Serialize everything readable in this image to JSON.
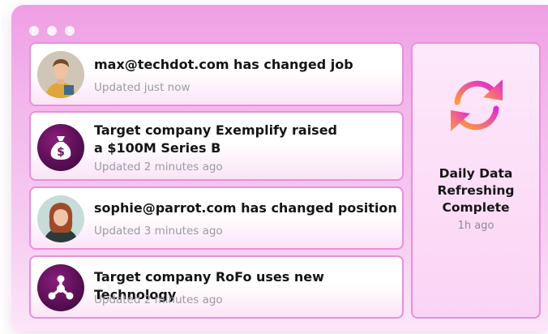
{
  "feed": [
    {
      "title": "max@techdot.com has changed job",
      "subtitle": "Updated just now",
      "avatar": "person-photo"
    },
    {
      "title_line1": "Target company Exemplify raised",
      "title_line2": "a $100M Series B",
      "subtitle": "Updated 2 minutes ago",
      "avatar": "money-bag-icon"
    },
    {
      "title": "sophie@parrot.com has changed position",
      "subtitle": "Updated 3 minutes ago",
      "avatar": "person-photo"
    },
    {
      "title": "Target company RoFo uses new Technology",
      "subtitle": "Updated 2 minutes ago",
      "avatar": "network-icon"
    }
  ],
  "status": {
    "title_line1": "Daily Data",
    "title_line2": "Refreshing",
    "title_line3": "Complete",
    "time": "1h ago",
    "icon": "refresh-icon"
  },
  "colors": {
    "accent_pink": "#e98fdb",
    "icon_purple": "#6b1463",
    "refresh_gradient_start": "#ff9a3c",
    "refresh_gradient_end": "#e02ad6"
  }
}
